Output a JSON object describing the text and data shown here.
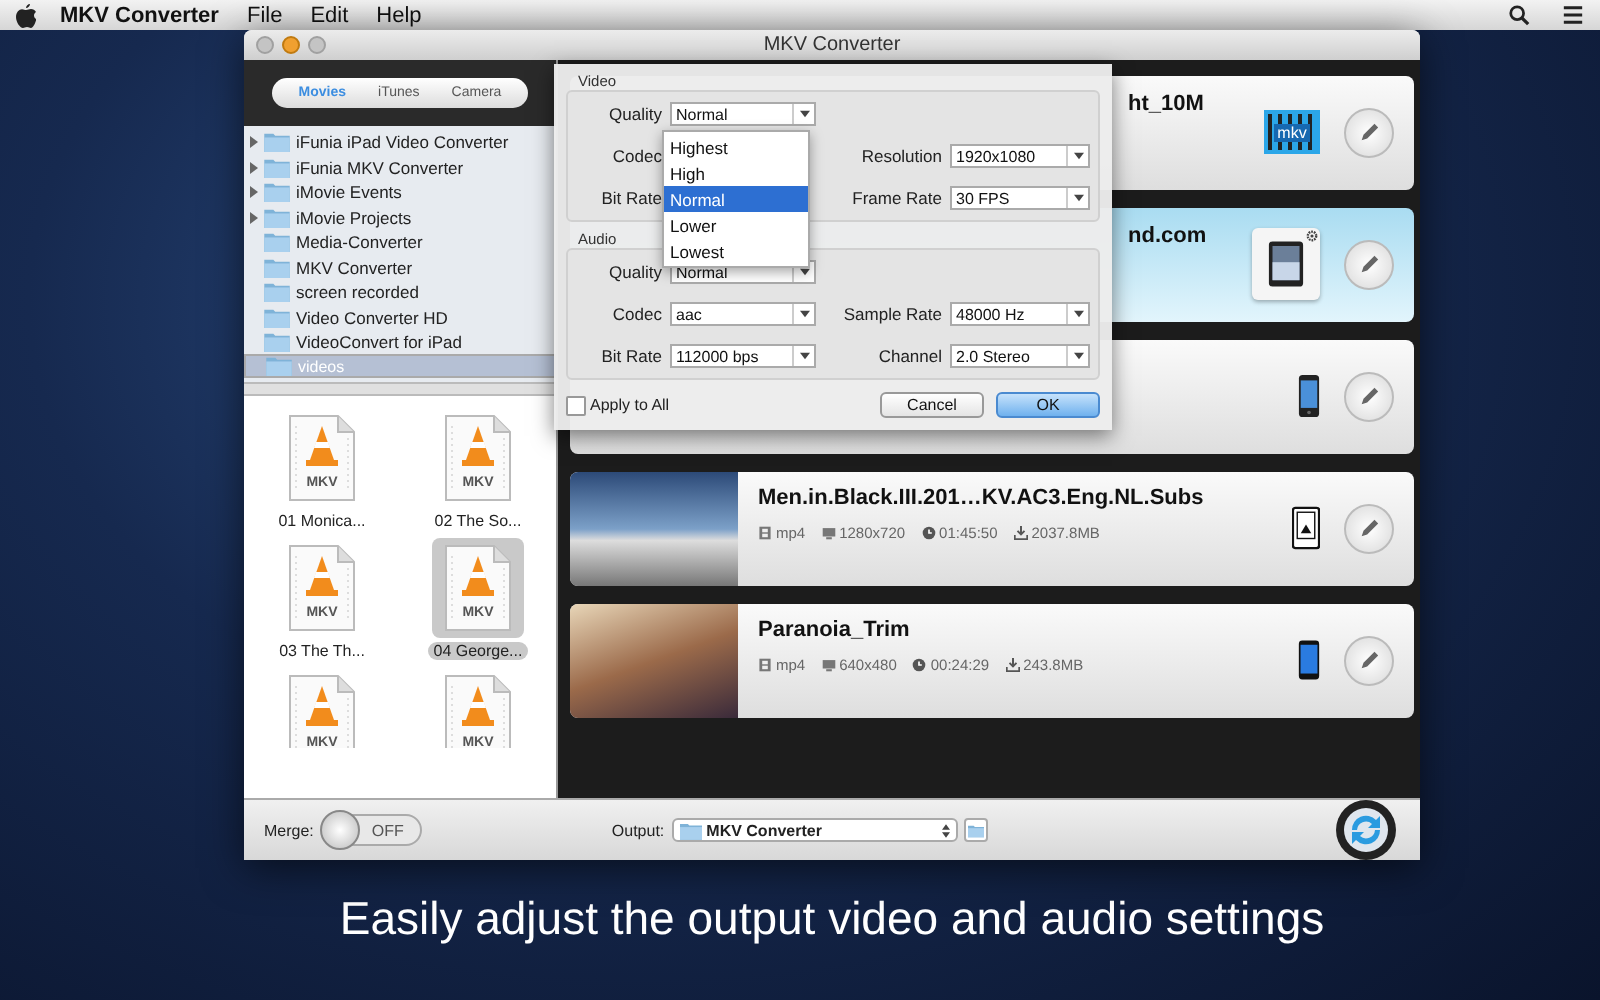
{
  "menu_bar": {
    "app": "MKV Converter",
    "items": [
      "File",
      "Edit",
      "Help"
    ]
  },
  "window": {
    "title": "MKV Converter"
  },
  "source_tabs": [
    {
      "label": "Movies",
      "selected": true
    },
    {
      "label": "iTunes",
      "selected": false
    },
    {
      "label": "Camera",
      "selected": false
    }
  ],
  "folders": [
    {
      "name": "iFunia iPad Video Converter",
      "expanded": false,
      "selected": false
    },
    {
      "name": "iFunia MKV Converter",
      "expanded": false,
      "selected": false
    },
    {
      "name": "iMovie Events",
      "expanded": false,
      "selected": false
    },
    {
      "name": "iMovie Projects",
      "expanded": false,
      "selected": false
    },
    {
      "name": "Media-Converter",
      "selected": false
    },
    {
      "name": "MKV Converter",
      "selected": false
    },
    {
      "name": "screen recorded",
      "selected": false
    },
    {
      "name": "Video Converter HD",
      "selected": false
    },
    {
      "name": "VideoConvert for iPad",
      "selected": false
    },
    {
      "name": "videos",
      "selected": true
    }
  ],
  "files": [
    {
      "name": "01 Monica...",
      "type": "MKV",
      "selected": false
    },
    {
      "name": "02 The So...",
      "type": "MKV",
      "selected": false
    },
    {
      "name": "03 The Th...",
      "type": "MKV",
      "selected": false
    },
    {
      "name": "04 George...",
      "type": "MKV",
      "selected": true
    },
    {
      "type": "MKV",
      "selected": false
    },
    {
      "type": "MKV",
      "selected": false
    }
  ],
  "videos": [
    {
      "kind": "partial",
      "title": "ht_10M",
      "device": {
        "kind": "mkv",
        "label": "mkv"
      },
      "selected": false
    },
    {
      "kind": "partial",
      "title": "nd.com",
      "device": {
        "kind": "ipad"
      },
      "selected": true
    },
    {
      "kind": "partial",
      "device": {
        "kind": "iphone"
      },
      "selected": false
    },
    {
      "kind": "full",
      "title": "Men.in.Black.III.201…KV.AC3.Eng.NL.Subs",
      "format": "mp4",
      "resolution": "1280x720",
      "duration": "01:45:50",
      "size": "2037.8MB",
      "device": {
        "kind": "kindle"
      },
      "selected": false
    },
    {
      "kind": "full",
      "title": "Paranoia_Trim",
      "format": "mp4",
      "resolution": "640x480",
      "duration": "00:24:29",
      "size": "243.8MB",
      "device": {
        "kind": "android"
      },
      "selected": false
    }
  ],
  "settings_dialog": {
    "video": {
      "title": "Video",
      "rows": [
        [
          {
            "label": "Quality",
            "value": "Normal"
          }
        ],
        [
          {
            "label": "Codec"
          },
          {
            "label": "Resolution",
            "value": "1920x1080"
          }
        ],
        [
          {
            "label": "Bit Rate"
          },
          {
            "label": "Frame Rate",
            "value": "30 FPS"
          }
        ]
      ]
    },
    "audio": {
      "title": "Audio",
      "rows": [
        [
          {
            "label": "Quality",
            "value": "Normal"
          }
        ],
        [
          {
            "label": "Codec",
            "value": "aac"
          },
          {
            "label": "Sample Rate",
            "value": "48000 Hz"
          }
        ],
        [
          {
            "label": "Bit Rate",
            "value": "112000 bps"
          },
          {
            "label": "Channel",
            "value": "2.0 Stereo"
          }
        ]
      ]
    },
    "quality_options": [
      {
        "label": "Highest",
        "selected": false
      },
      {
        "label": "High",
        "selected": false
      },
      {
        "label": "Normal",
        "selected": true
      },
      {
        "label": "Lower",
        "selected": false
      },
      {
        "label": "Lowest",
        "selected": false
      }
    ],
    "apply_to_all": {
      "label": "Apply to All",
      "checked": false
    },
    "buttons": [
      "Cancel",
      "OK"
    ]
  },
  "bottom_bar": {
    "merge": {
      "label": "Merge:",
      "on": false,
      "state_label": "OFF"
    },
    "output": {
      "label": "Output:",
      "value": "MKV Converter"
    }
  },
  "caption": "Easily adjust the output video and audio settings"
}
